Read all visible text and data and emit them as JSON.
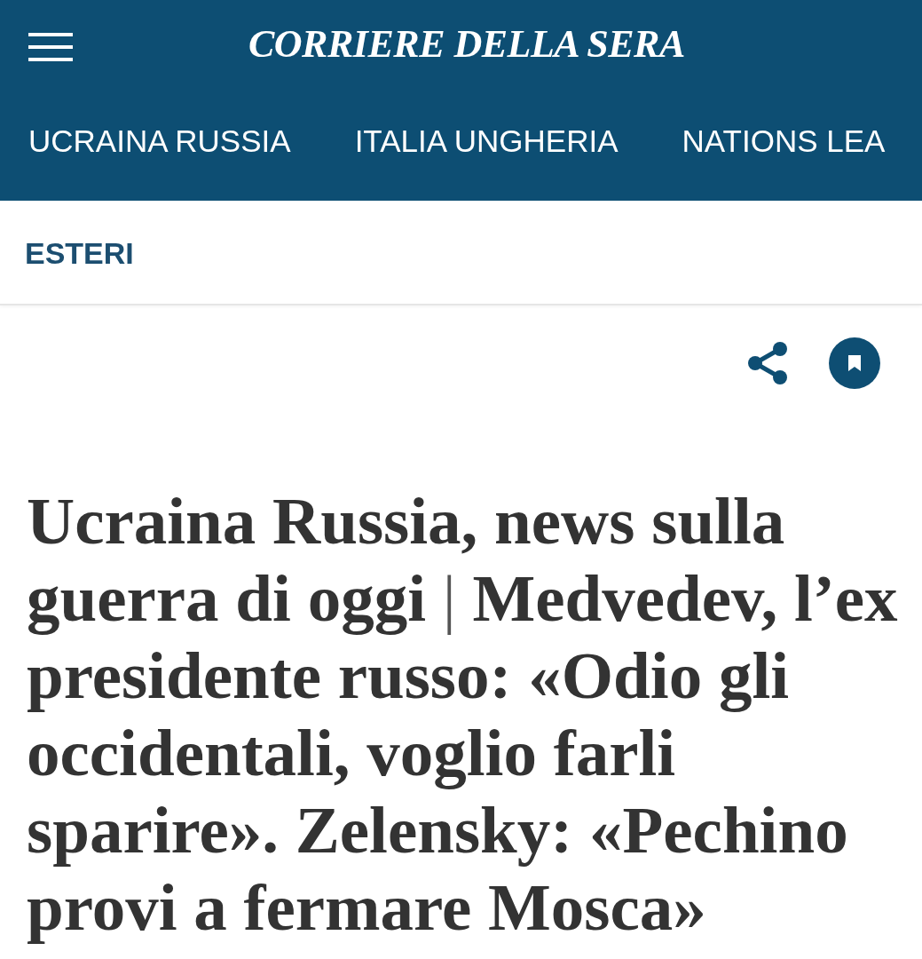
{
  "header": {
    "logo": "CORRIERE DELLA SERA",
    "nav": [
      "UCRAINA RUSSIA",
      "ITALIA UNGHERIA",
      "NATIONS LEA"
    ]
  },
  "section": {
    "label": "ESTERI"
  },
  "article": {
    "headline": {
      "parts": [
        "Ucraina Russia, news sulla guerra di oggi",
        "Medvedev, l’ex presidente russo: «Odio gli occidentali, voglio farli sparire». Zelensky: «Pechino provi a fermare Mosca»"
      ],
      "separator": "|"
    }
  }
}
